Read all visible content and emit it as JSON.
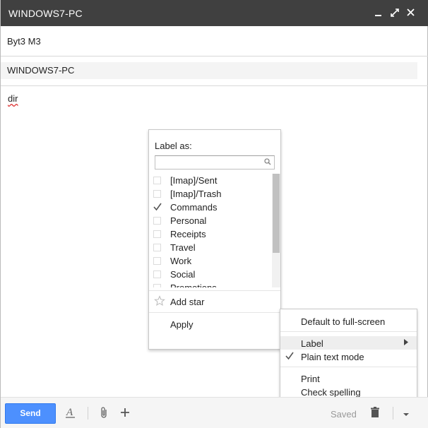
{
  "window": {
    "title": "WINDOWS7-PC",
    "controls": [
      "minimize-icon",
      "expand-icon",
      "close-icon"
    ]
  },
  "compose": {
    "to": "Byt3 M3",
    "subject": "WINDOWS7-PC",
    "body": "dir"
  },
  "label_popup": {
    "heading": "Label as:",
    "search_value": "",
    "labels": [
      {
        "name": "[Imap]/Sent",
        "checked": false
      },
      {
        "name": "[Imap]/Trash",
        "checked": false
      },
      {
        "name": "Commands",
        "checked": true
      },
      {
        "name": "Personal",
        "checked": false
      },
      {
        "name": "Receipts",
        "checked": false
      },
      {
        "name": "Travel",
        "checked": false
      },
      {
        "name": "Work",
        "checked": false
      },
      {
        "name": "Social",
        "checked": false
      },
      {
        "name": "Promotions",
        "checked": false
      }
    ],
    "add_star": "Add star",
    "apply": "Apply"
  },
  "more_menu": {
    "default_fullscreen": "Default to full-screen",
    "label": "Label",
    "plain_text": "Plain text mode",
    "plain_text_checked": true,
    "print": "Print",
    "check_spelling": "Check spelling"
  },
  "toolbar": {
    "send": "Send",
    "saved": "Saved",
    "icons": [
      "formatting-icon",
      "attach-icon",
      "more-insert-icon",
      "trash-icon",
      "more-options-icon"
    ]
  },
  "colors": {
    "titlebar": "#404040",
    "send_button": "#4d90fe",
    "menu_highlight": "#eeeeee"
  }
}
